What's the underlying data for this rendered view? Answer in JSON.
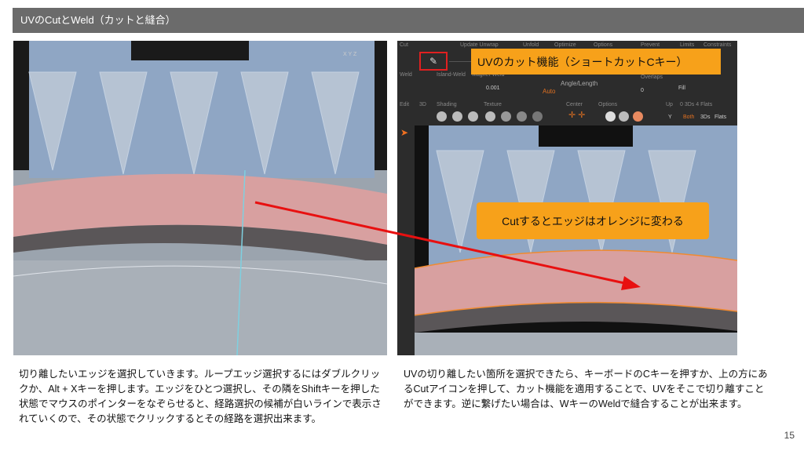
{
  "header": {
    "title": "UVのCutとWeld（カットと縫合）"
  },
  "left_image": {
    "axis_labels": "X Y Z"
  },
  "right_image": {
    "toolbar": {
      "cut": "Cut",
      "update_unwrap": "Update Unwrap",
      "unfold": "Unfold",
      "optimize": "Optimize",
      "options": "Options",
      "prevent": "Prevent",
      "limits": "Limits",
      "constraints": "Constraints",
      "weld": "Weld",
      "island_weld": "Island-Weld",
      "magnet_weld": "Magnet-Weld",
      "weld_value": "0.001",
      "auto": "Auto",
      "angle_length": "Angle/Length",
      "overlaps": "Overlaps",
      "overlaps_value": "0",
      "fill": "Fill",
      "edit": "Edit",
      "3d": "3D",
      "shading": "Shading",
      "texture": "Texture",
      "center": "Center",
      "options2": "Options",
      "up": "Up",
      "up_value": "Y",
      "counts": "0 3Ds 4 Flats",
      "both": "Both",
      "3ds": "3Ds",
      "flats": "Flats"
    },
    "callout_cut": "UVのカット機能（ショートカットCキー）",
    "callout_edge": "Cutするとエッジはオレンジに変わる"
  },
  "text_left": "切り離したいエッジを選択していきます。ループエッジ選択するにはダブルクリックか、Alt + Xキーを押します。エッジをひとつ選択し、その隣をShiftキーを押した状態でマウスのポインターをなぞらせると、経路選択の候補が白いラインで表示されていくので、その状態でクリックするとその経路を選択出来ます。",
  "text_right": "UVの切り離したい箇所を選択できたら、キーボードのCキーを押すか、上の方にあるCutアイコンを押して、カット機能を適用することで、UVをそこで切り離すことができます。逆に繋げたい場合は、WキーのWeldで縫合することが出来ます。",
  "page_number": "15"
}
